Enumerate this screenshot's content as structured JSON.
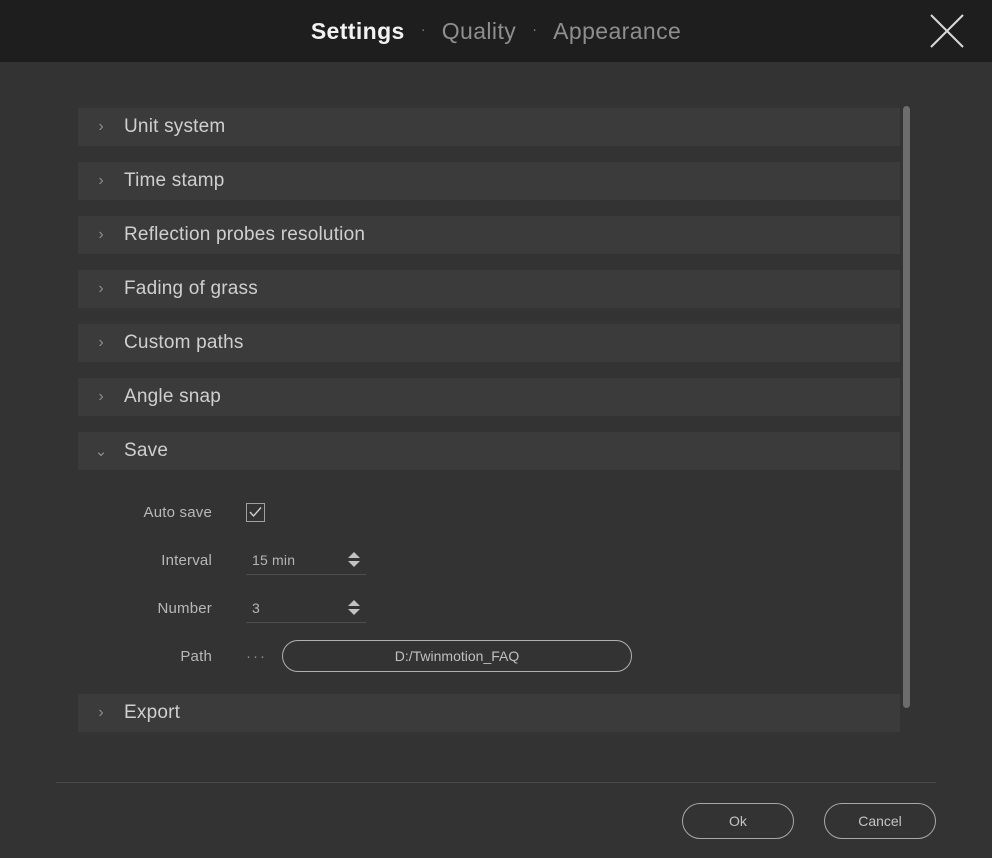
{
  "window": {
    "tabs": [
      {
        "label": "Settings",
        "active": true
      },
      {
        "label": "Quality",
        "active": false
      },
      {
        "label": "Appearance",
        "active": false
      }
    ],
    "tab_separator": "·",
    "close_icon": "close-icon"
  },
  "colors": {
    "header_bg": "#1e1e1e",
    "body_bg": "#333333",
    "row_bg": "#3b3b3b",
    "text_primary": "#f2f2f2",
    "text_muted": "#8e8e8e",
    "outline": "#a8a8a8",
    "scrollbar": "#6d6d6d"
  },
  "sections": [
    {
      "label": "Unit system",
      "expanded": false,
      "chevron": "chevron-right-icon",
      "chevron_glyph": "›"
    },
    {
      "label": "Time stamp",
      "expanded": false,
      "chevron": "chevron-right-icon",
      "chevron_glyph": "›"
    },
    {
      "label": "Reflection probes resolution",
      "expanded": false,
      "chevron": "chevron-right-icon",
      "chevron_glyph": "›"
    },
    {
      "label": "Fading of grass",
      "expanded": false,
      "chevron": "chevron-right-icon",
      "chevron_glyph": "›"
    },
    {
      "label": "Custom paths",
      "expanded": false,
      "chevron": "chevron-right-icon",
      "chevron_glyph": "›"
    },
    {
      "label": "Angle snap",
      "expanded": false,
      "chevron": "chevron-right-icon",
      "chevron_glyph": "›"
    },
    {
      "label": "Save",
      "expanded": true,
      "chevron": "chevron-down-icon",
      "chevron_glyph": "⌄"
    },
    {
      "label": "Export",
      "expanded": false,
      "chevron": "chevron-right-icon",
      "chevron_glyph": "›"
    }
  ],
  "save": {
    "auto_save": {
      "label": "Auto save",
      "checked": true,
      "check_icon": "checkmark-icon"
    },
    "interval": {
      "label": "Interval",
      "value": "15 min",
      "spinner": "stepper-arrows-icon"
    },
    "number": {
      "label": "Number",
      "value": "3",
      "spinner": "stepper-arrows-icon"
    },
    "path": {
      "label": "Path",
      "browse_glyph": "···",
      "value": "D:/Twinmotion_FAQ"
    }
  },
  "footer": {
    "ok_label": "Ok",
    "cancel_label": "Cancel"
  }
}
